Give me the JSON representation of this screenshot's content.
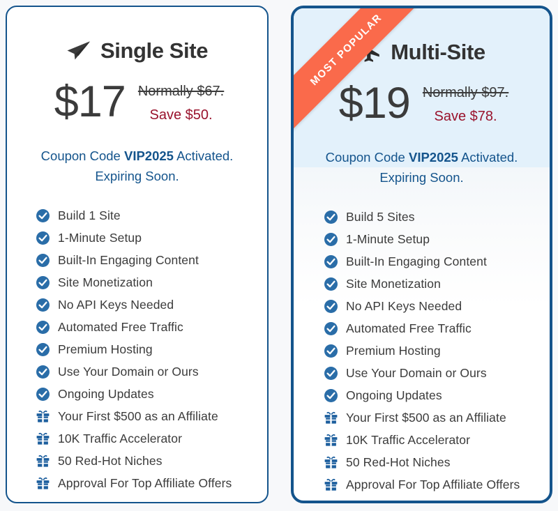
{
  "theme": {
    "page_bg": "#f7f8fa",
    "brand_blue": "#14548c",
    "check_blue": "#2a6da8",
    "gift_blue": "#1d5f9e",
    "ribbon_orange": "#fa6a4b",
    "save_red": "#99122c",
    "tint_blue": "#e3f1fb",
    "text_dark": "#3b3b3b"
  },
  "plans": [
    {
      "id": "single-site",
      "icon": "paper-plane-icon",
      "title": "Single Site",
      "price": "$17",
      "normally": "Normally $67.",
      "save": "Save $50.",
      "coupon_prefix": "Coupon Code ",
      "coupon_code": "VIP2025",
      "coupon_suffix": " Activated.",
      "coupon_line2": "Expiring Soon.",
      "popular": false,
      "features": [
        {
          "icon": "check-circle-icon",
          "label": "Build 1 Site"
        },
        {
          "icon": "check-circle-icon",
          "label": "1-Minute Setup"
        },
        {
          "icon": "check-circle-icon",
          "label": "Built-In Engaging Content"
        },
        {
          "icon": "check-circle-icon",
          "label": "Site Monetization"
        },
        {
          "icon": "check-circle-icon",
          "label": "No API Keys Needed"
        },
        {
          "icon": "check-circle-icon",
          "label": "Automated Free Traffic"
        },
        {
          "icon": "check-circle-icon",
          "label": "Premium Hosting"
        },
        {
          "icon": "check-circle-icon",
          "label": "Use Your Domain or Ours"
        },
        {
          "icon": "check-circle-icon",
          "label": "Ongoing Updates"
        },
        {
          "icon": "gift-icon",
          "label": "Your First $500 as an Affiliate"
        },
        {
          "icon": "gift-icon",
          "label": "10K Traffic Accelerator"
        },
        {
          "icon": "gift-icon",
          "label": "50 Red-Hot Niches"
        },
        {
          "icon": "gift-icon",
          "label": "Approval For Top Affiliate Offers"
        }
      ]
    },
    {
      "id": "multi-site",
      "icon": "airplane-icon",
      "title": "Multi-Site",
      "price": "$19",
      "normally": "Normally $97.",
      "save": "Save $78.",
      "coupon_prefix": "Coupon Code ",
      "coupon_code": "VIP2025",
      "coupon_suffix": " Activated.",
      "coupon_line2": "Expiring Soon.",
      "popular": true,
      "ribbon_label": "MOST POPULAR",
      "features": [
        {
          "icon": "check-circle-icon",
          "label": "Build 5 Sites"
        },
        {
          "icon": "check-circle-icon",
          "label": "1-Minute Setup"
        },
        {
          "icon": "check-circle-icon",
          "label": "Built-In Engaging Content"
        },
        {
          "icon": "check-circle-icon",
          "label": "Site Monetization"
        },
        {
          "icon": "check-circle-icon",
          "label": "No API Keys Needed"
        },
        {
          "icon": "check-circle-icon",
          "label": "Automated Free Traffic"
        },
        {
          "icon": "check-circle-icon",
          "label": "Premium Hosting"
        },
        {
          "icon": "check-circle-icon",
          "label": "Use Your Domain or Ours"
        },
        {
          "icon": "check-circle-icon",
          "label": "Ongoing Updates"
        },
        {
          "icon": "gift-icon",
          "label": "Your First $500 as an Affiliate"
        },
        {
          "icon": "gift-icon",
          "label": "10K Traffic Accelerator"
        },
        {
          "icon": "gift-icon",
          "label": "50 Red-Hot Niches"
        },
        {
          "icon": "gift-icon",
          "label": "Approval For Top Affiliate Offers"
        }
      ]
    }
  ]
}
